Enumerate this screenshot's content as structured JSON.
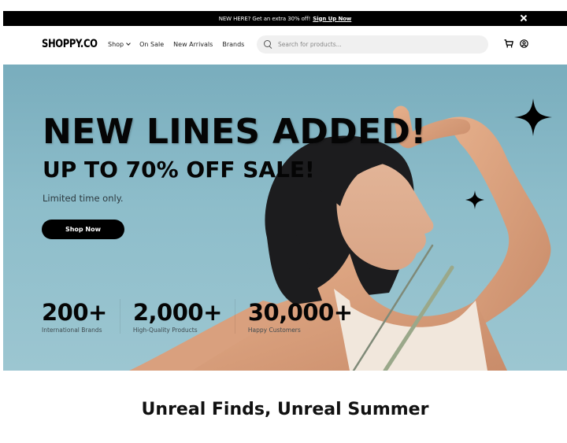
{
  "announcement": {
    "text": "NEW HERE? Get an extra 30% off!",
    "link_label": "Sign Up Now",
    "close_icon": "close-icon"
  },
  "nav": {
    "logo": "SHOPPY.CO",
    "links": [
      {
        "label": "Shop",
        "has_dropdown": true
      },
      {
        "label": "On Sale"
      },
      {
        "label": "New Arrivals"
      },
      {
        "label": "Brands"
      }
    ],
    "search": {
      "placeholder": "Search for products...",
      "value": "",
      "icon": "search-icon"
    },
    "icons": [
      "cart-icon",
      "account-icon"
    ]
  },
  "hero": {
    "headline": "NEW LINES ADDED!",
    "subheadline": "UP TO 70% OFF SALE!",
    "tagline": "Limited time only.",
    "cta_label": "Shop Now",
    "stats": [
      {
        "value": "200+",
        "label": "International Brands"
      },
      {
        "value": "2,000+",
        "label": "High-Quality Products"
      },
      {
        "value": "30,000+",
        "label": "Happy Customers"
      }
    ],
    "colors": {
      "sky": "#8dbdca",
      "text": "#050505"
    }
  },
  "section": {
    "title": "Unreal Finds, Unreal Summer"
  },
  "colors": {
    "announcement_bg": "#000000",
    "button_bg": "#000000",
    "search_bg": "#f0f0f0"
  }
}
